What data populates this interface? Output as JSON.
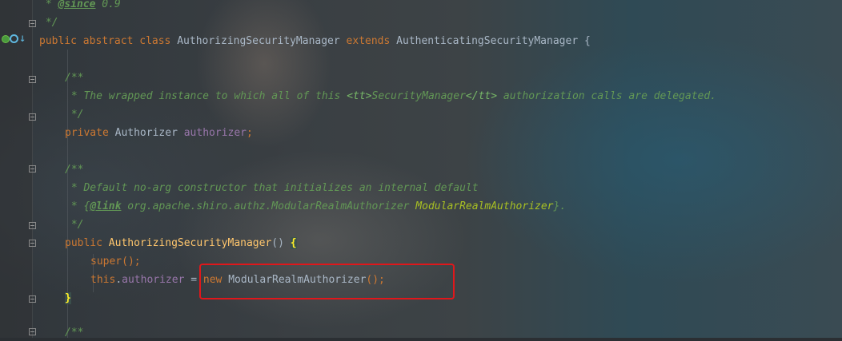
{
  "editor": {
    "lines": {
      "l1": {
        "star": " * ",
        "tag": "@since",
        "rest": " 0.9"
      },
      "l2": {
        "text": " */"
      },
      "l3": {
        "kw1": "public",
        "kw2": "abstract",
        "kw3": "class",
        "name": "AuthorizingSecurityManager",
        "kw4": "extends",
        "parent": "AuthenticatingSecurityManager",
        "brace": "{"
      },
      "l5": {
        "text": "/**"
      },
      "l6": {
        "pre": " * The wrapped instance to which all of this ",
        "tt_open": "<tt>",
        "tt_text": "SecurityManager",
        "tt_close": "</tt>",
        "post": " authorization calls are delegated."
      },
      "l7": {
        "text": " */"
      },
      "l8": {
        "kw": "private",
        "type": "Authorizer",
        "field": "authorizer",
        "semi": ";"
      },
      "l10": {
        "text": "/**"
      },
      "l11": {
        "text": " * Default no-arg constructor that initializes an internal default"
      },
      "l12": {
        "pre": " * {",
        "tag": "@link",
        "ref": " org.apache.shiro.authz.ModularRealmAuthorizer",
        "label": " ModularRealmAuthorizer",
        "post": "}."
      },
      "l13": {
        "text": " */"
      },
      "l14": {
        "kw": "public",
        "name": "AuthorizingSecurityManager",
        "parens": "() ",
        "brace": "{"
      },
      "l15": {
        "kw": "super",
        "rest": "();"
      },
      "l16": {
        "kw_this": "this",
        "dot": ".",
        "field": "authorizer",
        "eq": " = ",
        "kw_new": "new",
        "type": " ModularRealmAuthorizer",
        "rest": "();"
      },
      "l17": {
        "brace": "}"
      },
      "l19": {
        "text": "/**"
      }
    }
  },
  "colors": {
    "keyword": "#cc7832",
    "doc_comment": "#629755",
    "field": "#9876aa",
    "method": "#ffc66d",
    "annotation_box": "#e0171b"
  }
}
